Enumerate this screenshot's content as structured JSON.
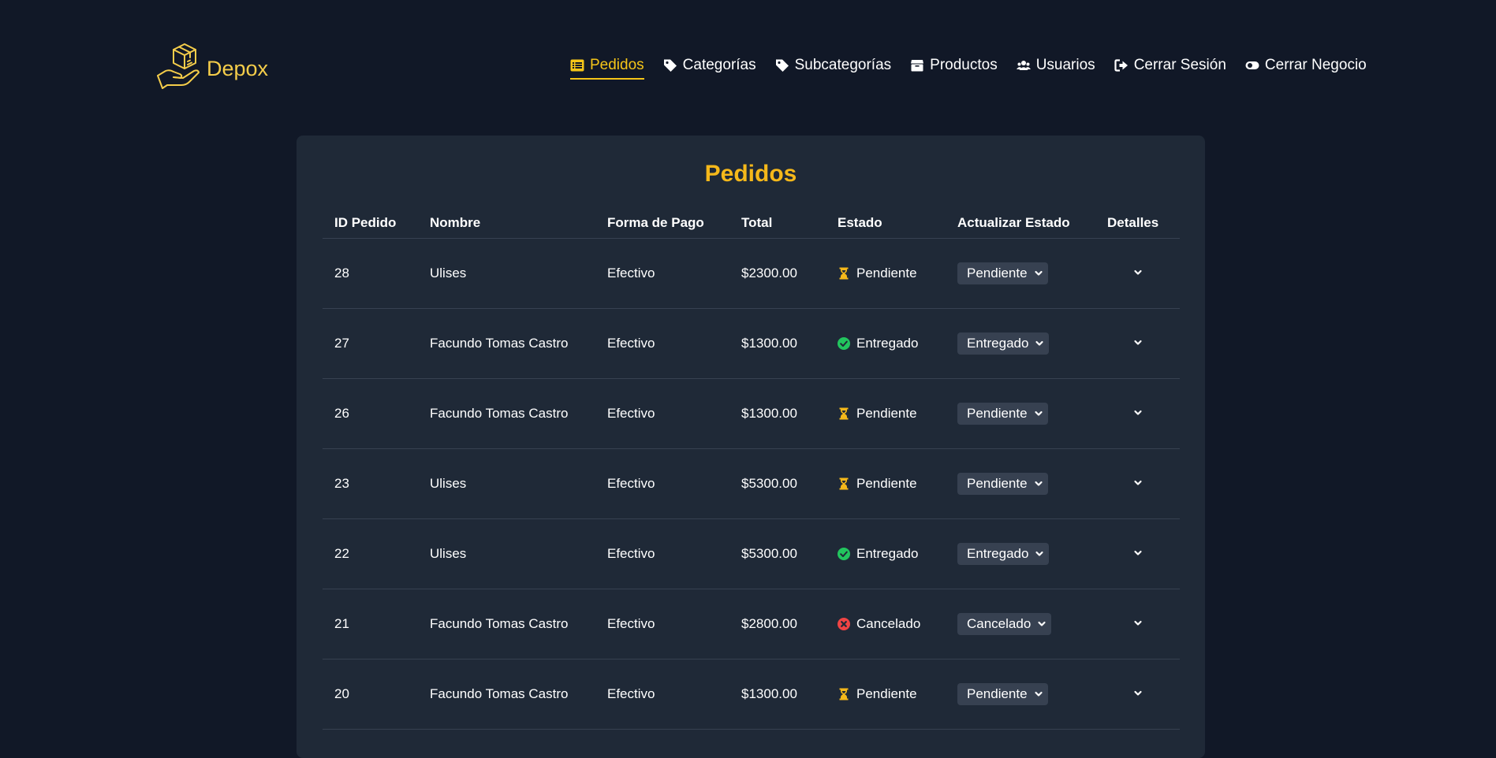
{
  "brand": {
    "name": "Depox"
  },
  "nav": [
    {
      "label": "Pedidos",
      "icon": "list-icon",
      "active": true
    },
    {
      "label": "Categorías",
      "icon": "tag-icon"
    },
    {
      "label": "Subcategorías",
      "icon": "tag-icon"
    },
    {
      "label": "Productos",
      "icon": "box-icon"
    },
    {
      "label": "Usuarios",
      "icon": "users-icon"
    },
    {
      "label": "Cerrar Sesión",
      "icon": "sign-out-icon"
    },
    {
      "label": "Cerrar Negocio",
      "icon": "toggle-icon"
    }
  ],
  "page": {
    "title": "Pedidos"
  },
  "table": {
    "headers": {
      "id": "ID Pedido",
      "name": "Nombre",
      "payment": "Forma de Pago",
      "total": "Total",
      "status": "Estado",
      "update": "Actualizar Estado",
      "details": "Detalles"
    },
    "rows": [
      {
        "id": "28",
        "name": "Ulises",
        "payment": "Efectivo",
        "total": "$2300.00",
        "status": "Pendiente",
        "select": "Pendiente"
      },
      {
        "id": "27",
        "name": "Facundo Tomas Castro",
        "payment": "Efectivo",
        "total": "$1300.00",
        "status": "Entregado",
        "select": "Entregado"
      },
      {
        "id": "26",
        "name": "Facundo Tomas Castro",
        "payment": "Efectivo",
        "total": "$1300.00",
        "status": "Pendiente",
        "select": "Pendiente"
      },
      {
        "id": "23",
        "name": "Ulises",
        "payment": "Efectivo",
        "total": "$5300.00",
        "status": "Pendiente",
        "select": "Pendiente"
      },
      {
        "id": "22",
        "name": "Ulises",
        "payment": "Efectivo",
        "total": "$5300.00",
        "status": "Entregado",
        "select": "Entregado"
      },
      {
        "id": "21",
        "name": "Facundo Tomas Castro",
        "payment": "Efectivo",
        "total": "$2800.00",
        "status": "Cancelado",
        "select": "Cancelado"
      },
      {
        "id": "20",
        "name": "Facundo Tomas Castro",
        "payment": "Efectivo",
        "total": "$1300.00",
        "status": "Pendiente",
        "select": "Pendiente"
      }
    ]
  },
  "colors": {
    "background": "#111827",
    "card": "#1f2937",
    "accent": "#f5c518",
    "pending": "#f5b81a",
    "delivered": "#22c55e",
    "cancelled": "#ef4444"
  }
}
